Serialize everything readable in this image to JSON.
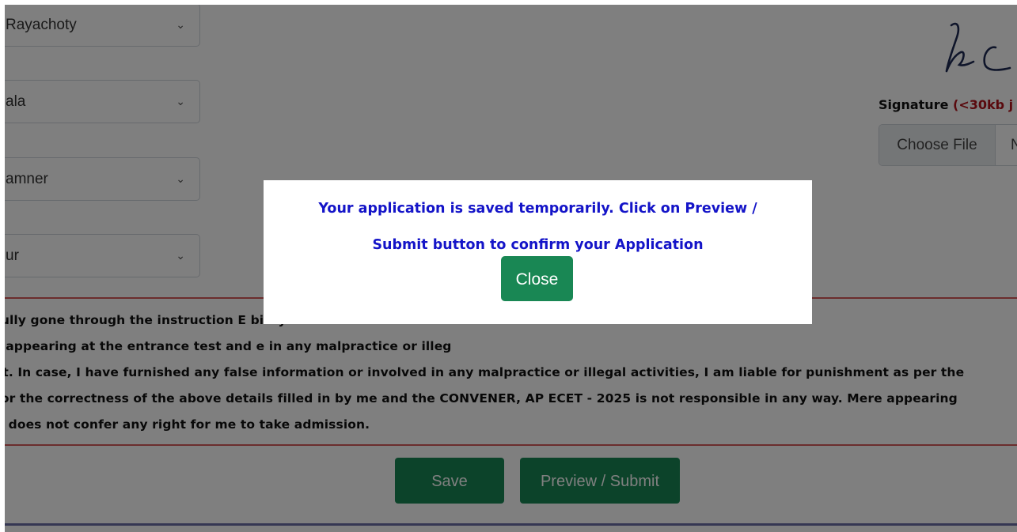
{
  "form": {
    "selects": [
      {
        "value": "Rayachoty"
      },
      {
        "value": "ala"
      },
      {
        "value": "amner"
      },
      {
        "value": "ur"
      }
    ]
  },
  "signature": {
    "label": "Signature",
    "hint": " (<30kb j",
    "file_button": "Choose File",
    "file_status": "N"
  },
  "declaration": {
    "lines": [
      "fully gone through the instruction E                                                                                                                                        bility conditions and other",
      "r appearing at the entrance test and                                                                                    e in any malpractice or illeg",
      "st. In case, I have furnished any false information or involved in any malpractice or illegal activities, I am liable for punishment as per the",
      "  for the correctness of the above details filled in by me and the CONVENER, AP ECET - 2025 is not responsible in any way. Mere appearing",
      "n does not confer any right for me to take admission."
    ]
  },
  "actions": {
    "save": "Save",
    "preview_submit": "Preview / Submit"
  },
  "modal": {
    "message_line1": "Your application is saved temporarily. Click on Preview /",
    "message_line2": "Submit button to confirm your Application",
    "close": "Close"
  },
  "colors": {
    "primary_green": "#198754",
    "modal_text": "#1414c8",
    "hint_red": "#b3131b",
    "declaration_border": "#d65a5a"
  }
}
